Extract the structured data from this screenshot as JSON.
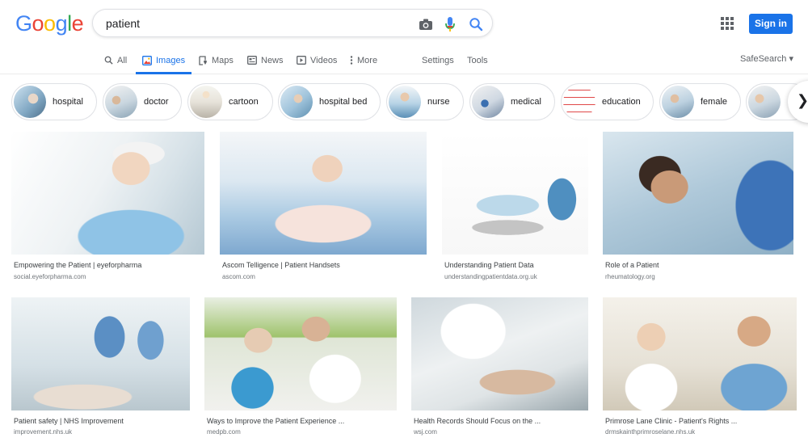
{
  "logo": [
    "G",
    "o",
    "o",
    "g",
    "l",
    "e"
  ],
  "logo_colors": [
    "#4285f4",
    "#ea4335",
    "#fbbc05",
    "#4285f4",
    "#34a853",
    "#ea4335"
  ],
  "search": {
    "value": "patient"
  },
  "header": {
    "sign_in": "Sign in"
  },
  "tabs": [
    {
      "label": "All",
      "icon": "search-icon"
    },
    {
      "label": "Images",
      "icon": "image-icon",
      "active": true
    },
    {
      "label": "Maps",
      "icon": "map-icon"
    },
    {
      "label": "News",
      "icon": "news-icon"
    },
    {
      "label": "Videos",
      "icon": "video-icon"
    },
    {
      "label": "More",
      "icon": "more-icon"
    },
    {
      "label": "Settings"
    },
    {
      "label": "Tools"
    }
  ],
  "safesearch": "SafeSearch ▾",
  "chips": [
    "hospital",
    "doctor",
    "cartoon",
    "hospital bed",
    "nurse",
    "medical",
    "education",
    "female"
  ],
  "results": [
    {
      "title": "Empowering the Patient | eyeforpharma",
      "domain": "social.eyeforpharma.com"
    },
    {
      "title": "Ascom Telligence | Patient Handsets",
      "domain": "ascom.com"
    },
    {
      "title": "Understanding Patient Data",
      "domain": "understandingpatientdata.org.uk"
    },
    {
      "title": "Role of a Patient",
      "domain": "rheumatology.org"
    },
    {
      "title": "Patient safety | NHS Improvement",
      "domain": "improvement.nhs.uk"
    },
    {
      "title": "Ways to Improve the Patient Experience ...",
      "domain": "medpb.com"
    },
    {
      "title": "Health Records Should Focus on the ...",
      "domain": "wsj.com"
    },
    {
      "title": "Primrose Lane Clinic - Patient's Rights ...",
      "domain": "drmskainthprimroselane.nhs.uk"
    }
  ],
  "colors": {
    "accent": "#1a73e8",
    "border": "#dfe1e5",
    "text_secondary": "#5f6368"
  }
}
